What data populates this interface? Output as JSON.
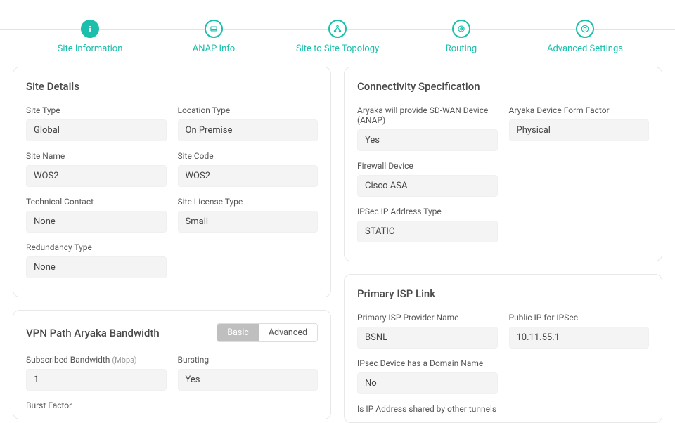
{
  "stepper": [
    {
      "label": "Site Information",
      "active": true
    },
    {
      "label": "ANAP Info",
      "active": false
    },
    {
      "label": "Site to Site Topology",
      "active": false
    },
    {
      "label": "Routing",
      "active": false
    },
    {
      "label": "Advanced Settings",
      "active": false
    }
  ],
  "siteDetails": {
    "title": "Site Details",
    "siteType": {
      "label": "Site Type",
      "value": "Global"
    },
    "locationType": {
      "label": "Location Type",
      "value": "On Premise"
    },
    "siteName": {
      "label": "Site Name",
      "value": "WOS2"
    },
    "siteCode": {
      "label": "Site Code",
      "value": "WOS2"
    },
    "techContact": {
      "label": "Technical Contact",
      "value": "None"
    },
    "licenseType": {
      "label": "Site License Type",
      "value": "Small"
    },
    "redundancy": {
      "label": "Redundancy Type",
      "value": "None"
    }
  },
  "bandwidth": {
    "title": "VPN Path Aryaka Bandwidth",
    "toggle": {
      "basic": "Basic",
      "advanced": "Advanced",
      "active": "basic"
    },
    "subscribed": {
      "label": "Subscribed Bandwidth",
      "unit": "(Mbps)",
      "value": "1"
    },
    "bursting": {
      "label": "Bursting",
      "value": "Yes"
    },
    "burstFactor": {
      "label": "Burst Factor"
    }
  },
  "connectivity": {
    "title": "Connectivity Specification",
    "sdwan": {
      "label": "Aryaka will provide SD-WAN Device (ANAP)",
      "value": "Yes"
    },
    "formFactor": {
      "label": "Aryaka Device Form Factor",
      "value": "Physical"
    },
    "firewall": {
      "label": "Firewall Device",
      "value": "Cisco ASA"
    },
    "ipsecType": {
      "label": "IPSec IP Address Type",
      "value": "STATIC"
    }
  },
  "primaryIsp": {
    "title": "Primary ISP Link",
    "provider": {
      "label": "Primary ISP Provider Name",
      "value": "BSNL"
    },
    "publicIp": {
      "label": "Public IP for IPSec",
      "value": "10.11.55.1"
    },
    "hasDomain": {
      "label": "IPsec Device has a Domain Name",
      "value": "No"
    },
    "sharedTunnels": {
      "label": "Is IP Address shared by other tunnels"
    }
  }
}
